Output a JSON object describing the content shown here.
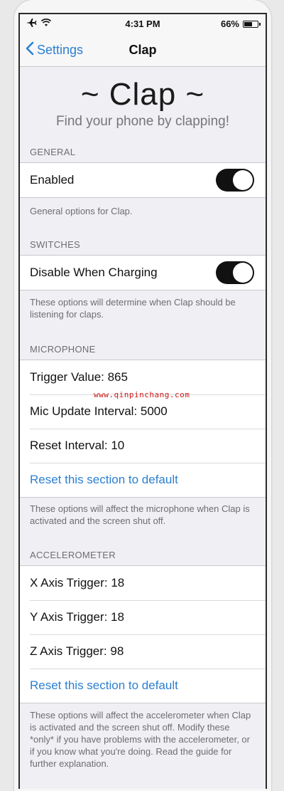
{
  "status_bar": {
    "time": "4:31 PM",
    "battery_label": "66%",
    "battery_level": 0.66,
    "icons": [
      "airplane-icon",
      "wifi-icon",
      "battery-icon"
    ]
  },
  "nav": {
    "back_label": "Settings",
    "title": "Clap"
  },
  "header": {
    "title": "~ Clap ~",
    "subtitle": "Find your phone by clapping!"
  },
  "general": {
    "section_label": "GENERAL",
    "enabled_label": "Enabled",
    "enabled_on": true,
    "footer": "General options for Clap."
  },
  "switches": {
    "section_label": "SWITCHES",
    "disable_charging_label": "Disable When Charging",
    "disable_charging_on": true,
    "footer": "These options will determine when Clap should be listening for claps."
  },
  "microphone": {
    "section_label": "MICROPHONE",
    "trigger_value": "Trigger Value:  865",
    "mic_update_interval": "Mic Update Interval:  5000",
    "reset_interval": "Reset Interval:  10",
    "reset_link": "Reset this section to default",
    "footer": "These options will affect the microphone when Clap is activated and the screen shut off."
  },
  "accelerometer": {
    "section_label": "ACCELEROMETER",
    "x_axis": "X Axis Trigger:  18",
    "y_axis": "Y Axis Trigger:  18",
    "z_axis": "Z Axis Trigger:  98",
    "reset_link": "Reset this section to default",
    "footer": "These options will affect the accelerometer when Clap is activated and the screen shut off. Modify these *only* if you have problems with the accelerometer, or if you know what you're doing. Read the guide for further explanation."
  },
  "watermark": "www.qinpinchang.com",
  "colors": {
    "accent": "#2b7fd1",
    "toggle_on": "#111111",
    "background": "#efeff4",
    "watermark": "#d01515"
  }
}
